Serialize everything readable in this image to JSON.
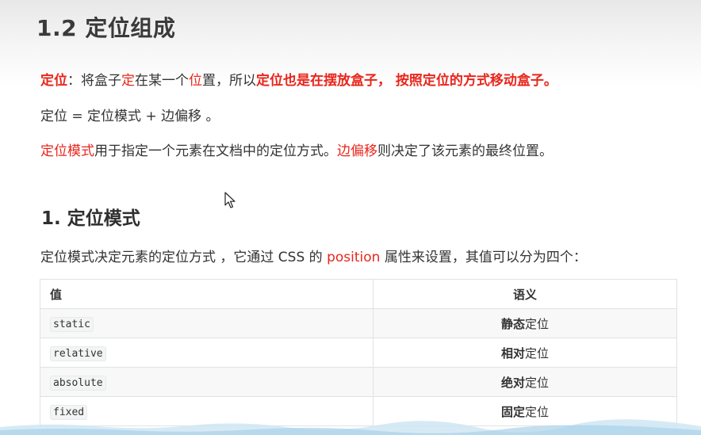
{
  "title": "1.2 定位组成",
  "intro": {
    "term": "定位",
    "seg1": "：将盒子",
    "seg2": "定",
    "seg3": "在某一个",
    "seg4": "位",
    "seg5": "置，所以",
    "seg6": "定位也是在摆放盒子， 按照定位的方式移动盒子。"
  },
  "formula": "定位 = 定位模式 + 边偏移 。",
  "explain": {
    "mode": "定位模式",
    "seg1": "用于指定一个元素在文档中的定位方式。",
    "offset": "边偏移",
    "seg2": "则决定了该元素的最终位置。"
  },
  "section": {
    "heading": "1. 定位模式",
    "desc_before": "定位模式决定元素的定位方式 ，它通过 CSS 的 ",
    "desc_keyword": "position",
    "desc_after": " 属性来设置，其值可以分为四个："
  },
  "table": {
    "headers": [
      "值",
      "语义"
    ],
    "rows": [
      {
        "value": "static",
        "meaning_strong": "静态",
        "meaning_rest": "定位"
      },
      {
        "value": "relative",
        "meaning_strong": "相对",
        "meaning_rest": "定位"
      },
      {
        "value": "absolute",
        "meaning_strong": "绝对",
        "meaning_rest": "定位"
      },
      {
        "value": "fixed",
        "meaning_strong": "固定",
        "meaning_rest": "定位"
      }
    ]
  },
  "icons": {
    "cursor": "mouse-pointer-icon"
  },
  "colors": {
    "accent_red": "#e8261c",
    "text": "#333333",
    "table_border": "#dfe2e5"
  }
}
